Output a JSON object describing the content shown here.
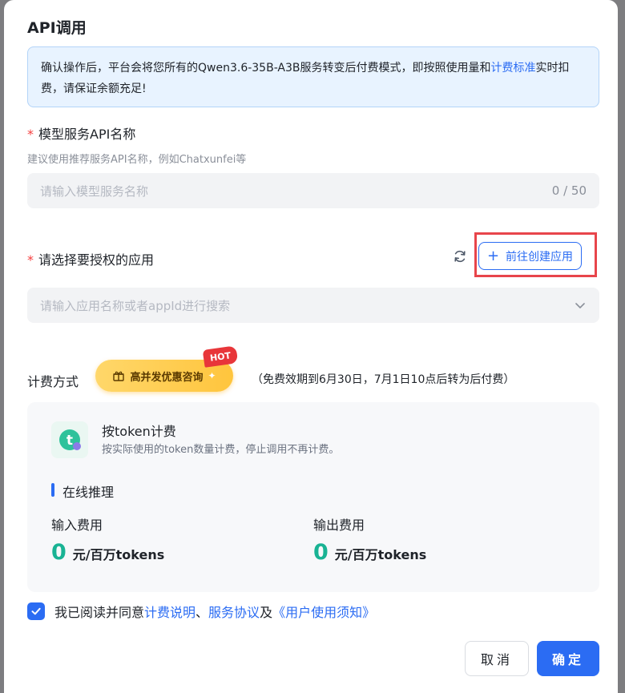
{
  "dialog": {
    "title": "API调用",
    "notice": {
      "text_before": "确认操作后，平台会将您所有的Qwen3.6-35B-A3B服务转变后付费模式，即按照使用量和",
      "link": "计费标准",
      "text_after": "实时扣费，请保证余额充足!"
    }
  },
  "form": {
    "required_mark": "*",
    "service_name": {
      "label": "模型服务API名称",
      "hint": "建议使用推荐服务API名称，例如Chatxunfei等",
      "placeholder": "请输入模型服务名称",
      "counter": "0 / 50"
    },
    "app_select": {
      "label": "请选择要授权的应用",
      "create_button": "前往创建应用",
      "placeholder": "请输入应用名称或者appId进行搜索"
    }
  },
  "billing": {
    "label": "计费方式",
    "promo_label": "高并发优惠咨询",
    "hot_badge": "HOT",
    "free_note": "（免费效期到6月30日，7月1日10点后转为后付费）",
    "card": {
      "title": "按token计费",
      "desc": "按实际使用的token数量计费，停止调用不再计费。",
      "section_title": "在线推理",
      "input_fee_label": "输入费用",
      "input_fee_value": "0",
      "output_fee_label": "输出费用",
      "output_fee_value": "0",
      "unit": "元/百万tokens"
    }
  },
  "agreement": {
    "checked": true,
    "prefix": "我已阅读并同意",
    "link1": "计费说明",
    "sep": "、",
    "link2": "服务协议",
    "and": "及",
    "link3": "《用户使用须知》"
  },
  "buttons": {
    "cancel": "取消",
    "ok": "确定"
  },
  "colors": {
    "primary": "#2b6cf3",
    "required": "#f53f3f",
    "price": "#19b394",
    "notice_bg": "#e8f3ff"
  }
}
